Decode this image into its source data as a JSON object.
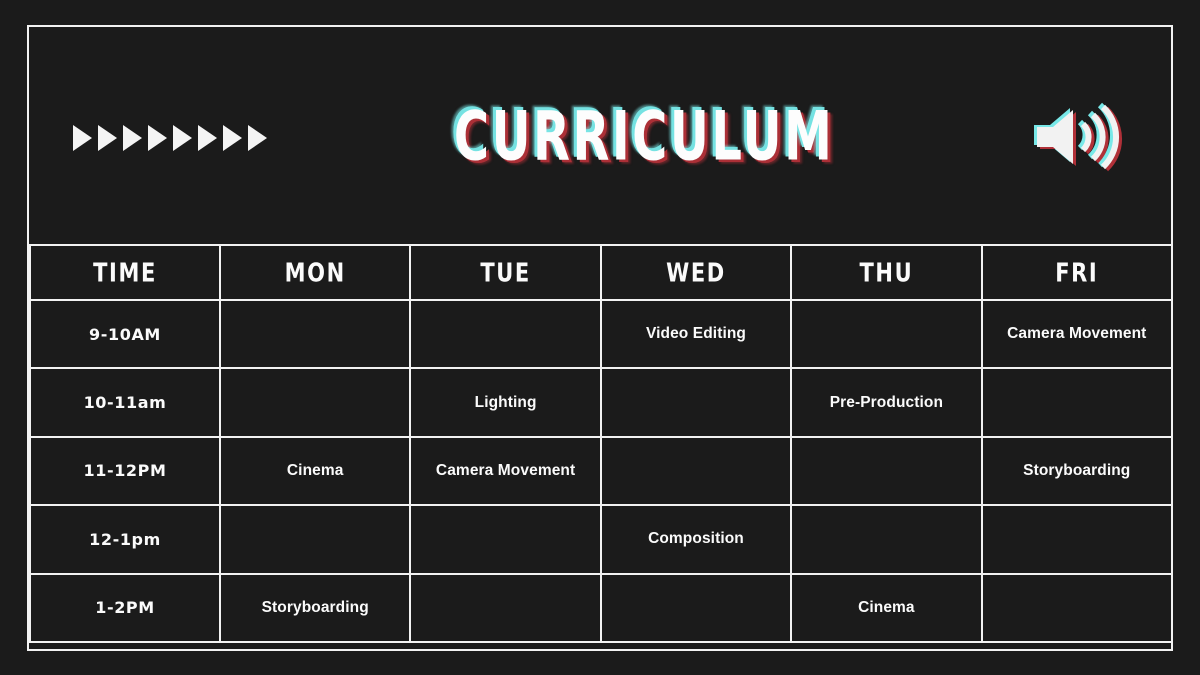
{
  "slide": {
    "background_color": "#1b1b1b",
    "frame_color": "#f2f2f2"
  },
  "header": {
    "title": "CURRICULUM",
    "title_color": "#fdfdfd",
    "chromatic_cyan": "#78e8e8",
    "chromatic_red": "#b03038",
    "arrow_count": 8,
    "arrow_icon": "play-triangle-icon",
    "arrow_color": "#f4f4f4",
    "speaker_icon": "speaker-volume-icon"
  },
  "table": {
    "columns": [
      "TIME",
      "MON",
      "TUE",
      "WED",
      "THU",
      "FRI"
    ],
    "rows": [
      {
        "time": "9-10AM",
        "cells": [
          "",
          "",
          "Video Editing",
          "",
          "Camera Movement"
        ]
      },
      {
        "time": "10-11am",
        "cells": [
          "",
          "Lighting",
          "",
          "Pre-Production",
          ""
        ]
      },
      {
        "time": "11-12PM",
        "cells": [
          "Cinema",
          "Camera Movement",
          "",
          "",
          "Storyboarding"
        ]
      },
      {
        "time": "12-1pm",
        "cells": [
          "",
          "",
          "Composition",
          "",
          ""
        ]
      },
      {
        "time": "1-2PM",
        "cells": [
          "Storyboarding",
          "",
          "",
          "Cinema",
          ""
        ]
      }
    ]
  }
}
